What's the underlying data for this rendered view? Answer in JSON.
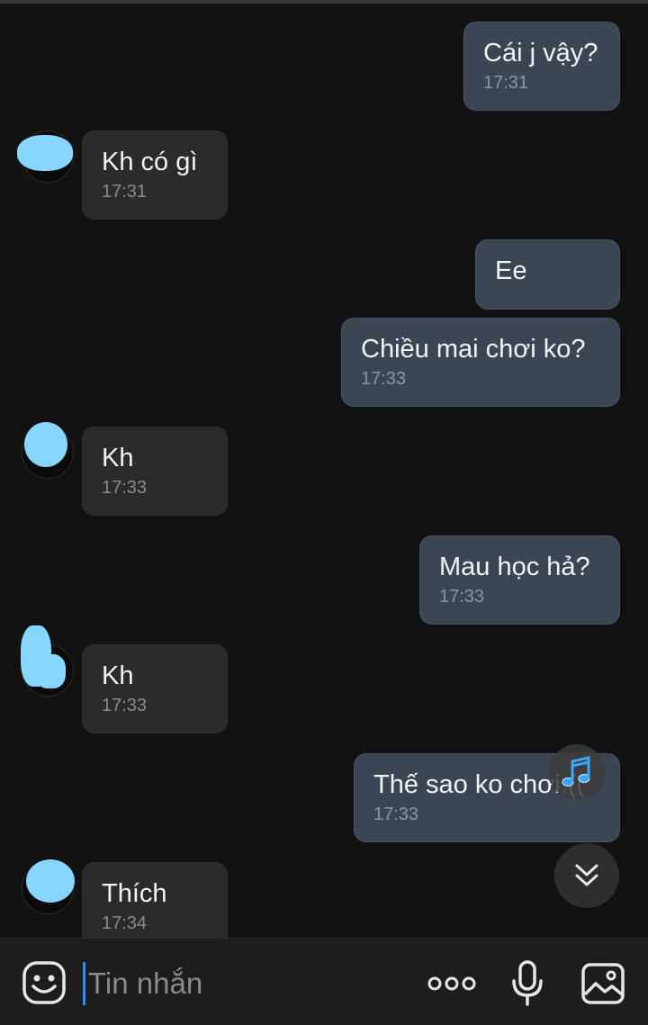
{
  "messages": [
    {
      "from": "me",
      "text": "Cái j vậy?",
      "time": "17:31"
    },
    {
      "from": "them",
      "text": "Kh có gì",
      "time": "17:31"
    },
    {
      "from": "me",
      "text": "Ee",
      "time": ""
    },
    {
      "from": "me",
      "text": "Chiều mai chơi ko?",
      "time": "17:33"
    },
    {
      "from": "them",
      "text": "Kh",
      "time": "17:33"
    },
    {
      "from": "me",
      "text": "Mau học hả?",
      "time": "17:33"
    },
    {
      "from": "them",
      "text": "Kh",
      "time": "17:33"
    },
    {
      "from": "me",
      "text": "Thế sao ko chơi:((",
      "time": "17:33"
    },
    {
      "from": "them",
      "text": "Thích",
      "time": "17:34"
    }
  ],
  "composer": {
    "placeholder": "Tin nhắn"
  },
  "icons": {
    "emoji": "emoji-icon",
    "more": "more-options-icon",
    "mic": "microphone-icon",
    "gallery": "image-gallery-icon",
    "music": "music-note-icon",
    "scroll": "scroll-down-icon"
  },
  "colors": {
    "accent": "#2d8cff",
    "bubble_me": "#3b4554",
    "bubble_them": "#2b2b2b",
    "background": "#121212"
  }
}
